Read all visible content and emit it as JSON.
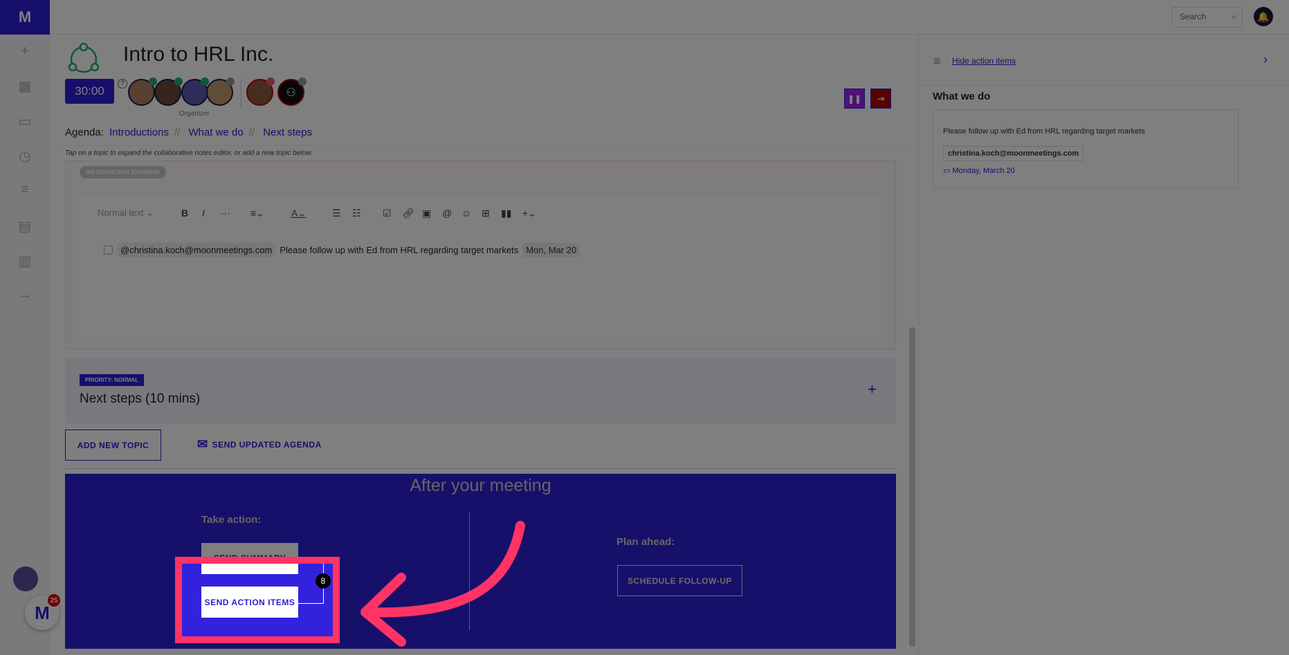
{
  "app": {
    "logo": "M",
    "sidebar_icons": [
      "plus-icon",
      "grid-icon",
      "calendar-icon",
      "clock-icon",
      "list-icon",
      "wallet-icon",
      "chart-icon",
      "arrow-right-icon"
    ],
    "notification_count": "25"
  },
  "topbar": {
    "search_placeholder": "Search"
  },
  "meeting": {
    "title": "Intro to HRL Inc.",
    "timer": "30:00",
    "organizer_label": "Organizer",
    "agenda_label": "Agenda:",
    "agenda_items": [
      "Introductions",
      "What we do",
      "Next steps"
    ],
    "agenda_separator": "//",
    "hint": "Tap on a topic to expand the collaborative notes editor, or add a new topic below."
  },
  "topics": [
    {
      "badge": "INFORMATION SHARING",
      "editor": {
        "style_select": "Normal text",
        "task": {
          "mention": "@christina.koch@moonmeetings.com",
          "text": "Please follow up with Ed from HRL regarding target markets",
          "date": "Mon, Mar 20"
        }
      }
    },
    {
      "badge": "PRIORITY: NORMAL",
      "title": "Next steps (10 mins)"
    }
  ],
  "actions": {
    "add_topic": "ADD NEW TOPIC",
    "send_agenda": "SEND UPDATED AGENDA"
  },
  "after": {
    "title": "After your meeting",
    "take_action": "Take action:",
    "send_summary": "SEND SUMMARY",
    "send_action_items": "SEND ACTION ITEMS",
    "plan_ahead": "Plan ahead:",
    "schedule": "SCHEDULE FOLLOW-UP"
  },
  "right_panel": {
    "hide_label": "Hide action items",
    "section": "What we do",
    "item": {
      "text": "Please follow up with Ed from HRL regarding target markets",
      "assignee": "christina.koch@moonmeetings.com",
      "date": "Monday, March 20"
    }
  },
  "colors": {
    "accent": "#2c20d4",
    "highlight": "#ff3366",
    "pause": "#a020f0",
    "exit": "#b00000"
  }
}
